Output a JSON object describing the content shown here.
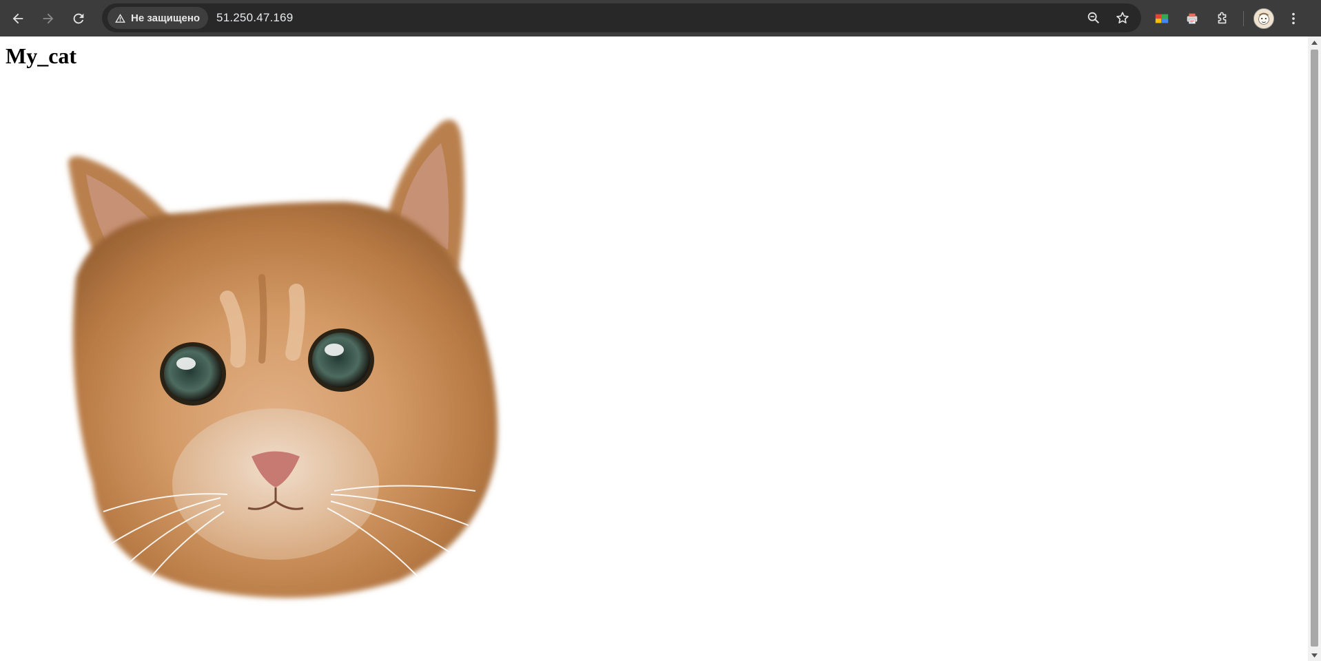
{
  "browser": {
    "security_label": "Не защищено",
    "url": "51.250.47.169",
    "icons": {
      "back": "back-arrow-icon",
      "forward": "forward-arrow-icon",
      "reload": "reload-icon",
      "warning": "warning-triangle-icon",
      "zoom": "zoom-icon",
      "bookmark": "star-icon",
      "extension_palette": "color-palette-extension-icon",
      "extension_print": "print-extension-icon",
      "extensions": "puzzle-icon",
      "profile": "avatar",
      "menu": "kebab-menu-icon"
    },
    "colors": {
      "toolbar_bg": "#3c3c3c",
      "omnibox_bg": "#282828",
      "icon": "#e3e3e3"
    }
  },
  "page": {
    "heading": "My_cat",
    "image": "cat-face-image"
  }
}
